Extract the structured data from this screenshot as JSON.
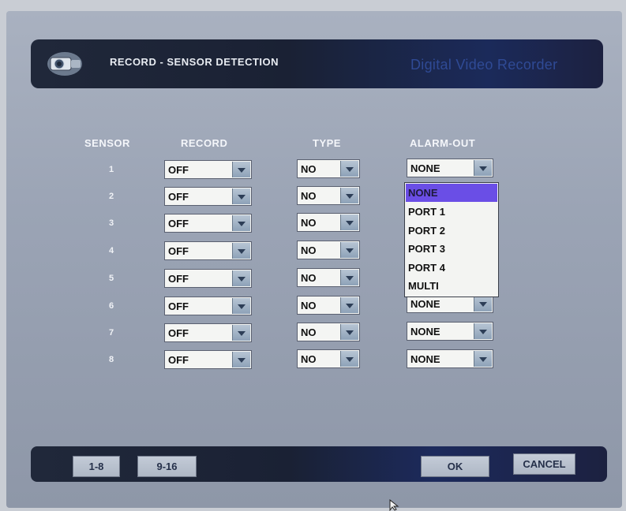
{
  "header": {
    "title": "RECORD - SENSOR DETECTION",
    "brand": "Digital Video Recorder"
  },
  "columns": {
    "sensor": "SENSOR",
    "record": "RECORD",
    "type": "TYPE",
    "alarm_out": "ALARM-OUT"
  },
  "rows": [
    {
      "sensor": "1",
      "record": "OFF",
      "type": "NO",
      "alarm_out": "NONE"
    },
    {
      "sensor": "2",
      "record": "OFF",
      "type": "NO",
      "alarm_out": ""
    },
    {
      "sensor": "3",
      "record": "OFF",
      "type": "NO",
      "alarm_out": ""
    },
    {
      "sensor": "4",
      "record": "OFF",
      "type": "NO",
      "alarm_out": ""
    },
    {
      "sensor": "5",
      "record": "OFF",
      "type": "NO",
      "alarm_out": ""
    },
    {
      "sensor": "6",
      "record": "OFF",
      "type": "NO",
      "alarm_out": "NONE"
    },
    {
      "sensor": "7",
      "record": "OFF",
      "type": "NO",
      "alarm_out": "NONE"
    },
    {
      "sensor": "8",
      "record": "OFF",
      "type": "NO",
      "alarm_out": "NONE"
    }
  ],
  "alarm_menu": {
    "options": [
      "NONE",
      "PORT 1",
      "PORT 2",
      "PORT 3",
      "PORT 4",
      "MULTI"
    ],
    "highlighted": "NONE"
  },
  "footer": {
    "page_1_8": "1-8",
    "page_9_16": "9-16",
    "ok": "OK",
    "cancel": "CANCEL"
  },
  "colors": {
    "highlight": "#6a4ee6",
    "panel": "#1a2134"
  }
}
